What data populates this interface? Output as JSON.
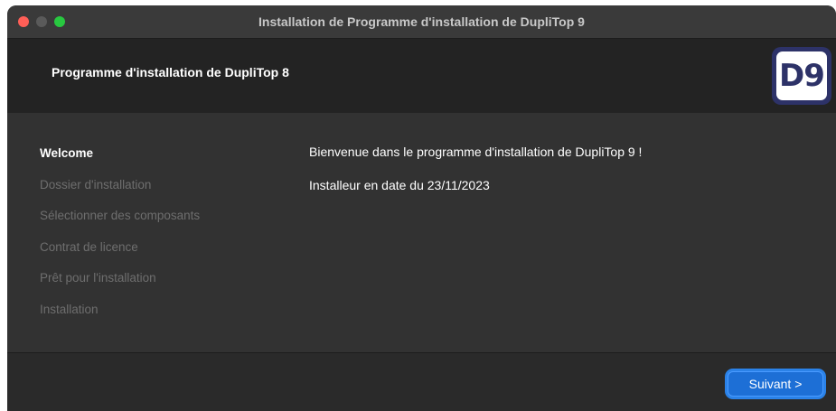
{
  "window": {
    "title": "Installation de Programme d'installation de DupliTop 9"
  },
  "header": {
    "title": "Programme d'installation de DupliTop 8",
    "logo_text": "D9"
  },
  "steps": [
    {
      "label": "Welcome",
      "active": true
    },
    {
      "label": "Dossier d'installation",
      "active": false
    },
    {
      "label": "Sélectionner des composants",
      "active": false
    },
    {
      "label": "Contrat de licence",
      "active": false
    },
    {
      "label": "Prêt pour l'installation",
      "active": false
    },
    {
      "label": "Installation",
      "active": false
    }
  ],
  "content": {
    "welcome_text": "Bienvenue dans le programme d'installation de DupliTop 9 !",
    "date_text": "Installeur en date du 23/11/2023"
  },
  "footer": {
    "next_label": "Suivant >"
  },
  "colors": {
    "accent": "#1d6fd6",
    "logo_bg": "#2d3268",
    "close": "#ff5f57",
    "zoom": "#28c840"
  }
}
